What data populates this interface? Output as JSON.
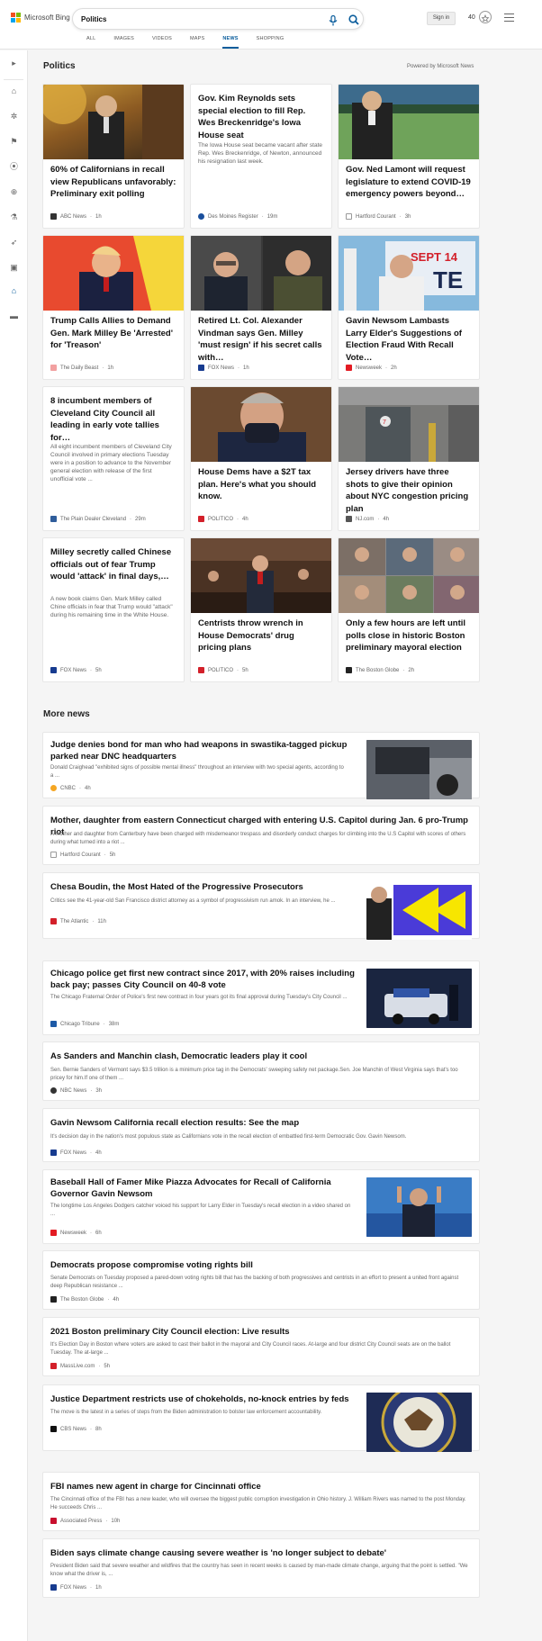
{
  "header": {
    "brand": "Microsoft Bing",
    "search_value": "Politics",
    "signin_label": "Sign in",
    "points": "40",
    "tabs": [
      "ALL",
      "IMAGES",
      "VIDEOS",
      "MAPS",
      "NEWS",
      "SHOPPING"
    ],
    "active_tab": "NEWS"
  },
  "rail_icons": [
    "chevron-right-icon",
    "home-icon",
    "coronavirus-icon",
    "flag-icon",
    "location-icon",
    "globe-icon",
    "microscope-icon",
    "rocket-icon",
    "film-icon",
    "politics-icon",
    "wallet-icon"
  ],
  "section_title": "Politics",
  "powered_by": "Powered by Microsoft News",
  "cards": [
    {
      "title": "60% of Californians in recall view Republicans unfavorably: Preliminary exit polling",
      "source": "ABC News",
      "time": "1h",
      "source_color": "#333333"
    },
    {
      "title": "Gov. Kim Reynolds sets special election to fill Rep. Wes Breckenridge's Iowa House seat",
      "desc": "The Iowa House seat became vacant after state Rep. Wes Breckenridge, of Newton, announced his resignation last week.",
      "source": "Des Moines Register",
      "time": "19m",
      "source_color": "#1a4f9c"
    },
    {
      "title": "Gov. Ned Lamont will request legislature to extend COVID-19 emergency powers beyond…",
      "source": "Hartford Courant",
      "time": "3h",
      "source_color": "#555555"
    },
    {
      "title": "Trump Calls Allies to Demand Gen. Mark Milley Be 'Arrested' for 'Treason'",
      "source": "The Daily Beast",
      "time": "1h",
      "source_color": "#f2a0a0"
    },
    {
      "title": "Retired Lt. Col. Alexander Vindman says Gen. Milley 'must resign' if his secret calls with…",
      "source": "FOX News",
      "time": "1h",
      "source_color": "#173b8f"
    },
    {
      "title": "Gavin Newsom Lambasts Larry Elder's Suggestions of Election Fraud With Recall Vote…",
      "source": "Newsweek",
      "time": "2h",
      "source_color": "#e31b23"
    },
    {
      "title": "8 incumbent members of Cleveland City Council all leading in early vote tallies for…",
      "desc": "All eight incumbent members of Cleveland City Council involved in primary elections Tuesday were in a position to advance to the November general election with release of the first unofficial vote ...",
      "source": "The Plain Dealer Cleveland",
      "time": "29m",
      "source_color": "#2f5d9b"
    },
    {
      "title": "House Dems have a $2T tax plan. Here's what you should know.",
      "source": "POLITICO",
      "time": "4h",
      "source_color": "#d3202a"
    },
    {
      "title": "Jersey drivers have three shots to give their opinion about NYC congestion pricing plan",
      "source": "NJ.com",
      "time": "4h",
      "source_color": "#555555"
    },
    {
      "title": "Milley secretly called Chinese officials out of fear Trump would 'attack' in final days,…",
      "desc": "A new book claims Gen. Mark Milley called Chine officials in fear that Trump would \"attack\" during his remaining time in the White House.",
      "source": "FOX News",
      "time": "5h",
      "source_color": "#173b8f"
    },
    {
      "title": "Centrists throw wrench in House Democrats' drug pricing plans",
      "source": "POLITICO",
      "time": "5h",
      "source_color": "#d3202a"
    },
    {
      "title": "Only a few hours are left until polls close in historic Boston preliminary mayoral election",
      "source": "The Boston Globe",
      "time": "2h",
      "source_color": "#222222"
    }
  ],
  "more_title": "More news",
  "more_news": [
    {
      "title": "Judge denies bond for man who had weapons in swastika-tagged pickup parked near DNC headquarters",
      "desc": "Donald Craighead \"exhibited signs of possible mental illness\" throughout an interview with two special agents, according to a ...",
      "source": "CNBC",
      "time": "4h",
      "has_image": true,
      "source_color": "#f5a623"
    },
    {
      "title": "Mother, daughter from eastern Connecticut charged with entering U.S. Capitol during Jan. 6 pro-Trump riot",
      "desc": "A mother and daughter from Canterbury have been charged with misdemeanor trespass and disorderly conduct charges for climbing into the U.S Capitol with scores of others during what turned into a riot ...",
      "source": "Hartford Courant",
      "time": "5h",
      "has_image": false,
      "source_color": "#555555"
    },
    {
      "title": "Chesa Boudin, the Most Hated of the Progressive Prosecutors",
      "desc": "Critics see the 41-year-old San Francisco district attorney as a symbol of progressivism run amok. In an interview, he ...",
      "source": "The Atlantic",
      "time": "11h",
      "has_image": true,
      "source_color": "#d3202a"
    },
    {
      "title": "Chicago police get first new contract since 2017, with 20% raises including back pay; passes City Council on 40-8 vote",
      "desc": "The Chicago Fraternal Order of Police's first new contract in four years got its final approval during Tuesday's City Council ...",
      "source": "Chicago Tribune",
      "time": "38m",
      "has_image": true,
      "source_color": "#1d5aa6"
    },
    {
      "title": "As Sanders and Manchin clash, Democratic leaders play it cool",
      "desc": "Sen. Bernie Sanders of Vermont says $3.5 trillion is a minimum price tag in the Democrats' sweeping safety net package.Sen. Joe Manchin of West Virginia says that's too pricey for him.If one of them ...",
      "source": "NBC News",
      "time": "3h",
      "has_image": false,
      "source_color": "#333333"
    },
    {
      "title": "Gavin Newsom California recall election results: See the map",
      "desc": "It's decision day in the nation's most populous state as Californians vote in the recall election of embattled first-term Democratic Gov. Gavin Newsom.",
      "source": "FOX News",
      "time": "4h",
      "has_image": false,
      "source_color": "#173b8f"
    },
    {
      "title": "Baseball Hall of Famer Mike Piazza Advocates for Recall of California Governor Gavin Newsom",
      "desc": "The longtime Los Angeles Dodgers catcher voiced his support for Larry Elder in Tuesday's recall election in a video shared on ...",
      "source": "Newsweek",
      "time": "6h",
      "has_image": true,
      "source_color": "#e31b23"
    },
    {
      "title": "Democrats propose compromise voting rights bill",
      "desc": "Senate Democrats on Tuesday proposed a pared-down voting rights bill that has the backing of both progressives and centrists in an effort to present a united front against deep Republican resistance ...",
      "source": "The Boston Globe",
      "time": "4h",
      "has_image": false,
      "source_color": "#222222"
    },
    {
      "title": "2021 Boston preliminary City Council election: Live results",
      "desc": "It's Election Day in Boston where voters are asked to cast their ballot in the mayoral and City Council races. At-large and four district City Council seats are on the ballot Tuesday. The at-large ...",
      "source": "MassLive.com",
      "time": "5h",
      "has_image": false,
      "source_color": "#d3202a"
    },
    {
      "title": "Justice Department restricts use of chokeholds, no-knock entries by feds",
      "desc": "The move is the latest in a series of steps from the Biden administration to bolster law enforcement accountability.",
      "source": "CBS News",
      "time": "8h",
      "has_image": true,
      "source_color": "#111111"
    },
    {
      "title": "FBI names new agent in charge for Cincinnati office",
      "desc": "The Cincinnati office of the FBI has a new leader, who will oversee the biggest public corruption investigation in Ohio history. J. William Rivers was named to the post Monday. He succeeds Chris ...",
      "source": "Associated Press",
      "time": "10h",
      "has_image": false,
      "source_color": "#c8102e"
    },
    {
      "title": "Biden says climate change causing severe weather is 'no longer subject to debate'",
      "desc": "President Biden said that severe weather and wildfires that the country has seen in recent weeks is caused by man-made climate change, arguing that the point is settled. \"We know what the driver is, ...",
      "source": "FOX News",
      "time": "1h",
      "has_image": false,
      "source_color": "#173b8f"
    }
  ]
}
